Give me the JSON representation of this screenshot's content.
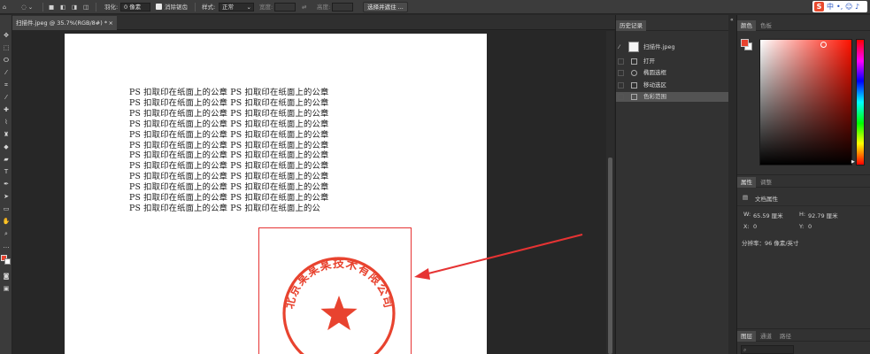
{
  "options_bar": {
    "feather_label": "羽化:",
    "feather_value": "0 像素",
    "antialias_label": "消除锯齿",
    "style_label": "样式:",
    "style_value": "正常",
    "width_label": "宽度:",
    "height_label": "高度:",
    "select_mask_button": "选择并遮住 ...",
    "swap_icon": "swap-arrows-icon"
  },
  "document": {
    "tab_title": "扫描件.jpeg @ 35.7%(RGB/8#) *",
    "text_lines": [
      "PS 扣取印在纸面上的公章 PS 扣取印在纸面上的公章",
      "PS 扣取印在纸面上的公章 PS 扣取印在纸面上的公章",
      "PS 扣取印在纸面上的公章 PS 扣取印在纸面上的公章",
      "PS 扣取印在纸面上的公章 PS 扣取印在纸面上的公章",
      "PS 扣取印在纸面上的公章 PS 扣取印在纸面上的公章",
      "PS 扣取印在纸面上的公章 PS 扣取印在纸面上的公章",
      "PS 扣取印在纸面上的公章 PS 扣取印在纸面上的公章",
      "PS 扣取印在纸面上的公章 PS 扣取印在纸面上的公章",
      "PS 扣取印在纸面上的公章 PS 扣取印在纸面上的公章",
      "PS 扣取印在纸面上的公章 PS 扣取印在纸面上的公章",
      "PS 扣取印在纸面上的公章 PS 扣取印在纸面上的公章",
      "PS 扣取印在纸面上的公章 PS 扣取印在纸面上的公"
    ],
    "seal_text": "北京某某某技术有限公司",
    "seal_color": "#e8432f",
    "highlight_color": "#e63333"
  },
  "history_panel": {
    "tab_history": "历史记录",
    "snapshot_name": "扫描件.jpeg",
    "items": [
      "打开",
      "椭圆选框",
      "移动选区",
      "色彩范围"
    ],
    "selected_index": 3
  },
  "color_panel": {
    "tab_color": "颜色",
    "tab_swatches": "色板",
    "foreground": "#e8432f",
    "background": "#ffffff"
  },
  "properties_panel": {
    "tab_properties": "属性",
    "tab_adjustments": "调整",
    "doc_props_label": "文档属性",
    "w_label": "W:",
    "w_value": "65.59 厘米",
    "h_label": "H:",
    "h_value": "92.79 厘米",
    "x_label": "X:",
    "x_value": "0",
    "y_label": "Y:",
    "y_value": "0",
    "resolution": "分辨率：96 像素/英寸"
  },
  "layers_panel": {
    "tab_layers": "图层",
    "tab_channels": "通道",
    "tab_paths": "路径"
  },
  "ime": {
    "brand": "S",
    "lang": "中"
  }
}
